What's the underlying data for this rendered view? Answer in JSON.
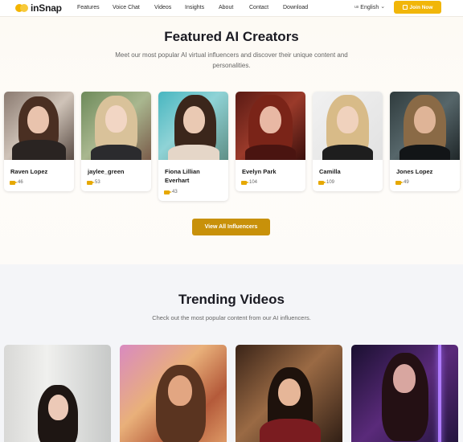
{
  "brand": {
    "name": "inSnap"
  },
  "nav": {
    "links": [
      "Features",
      "Voice Chat",
      "Videos",
      "Insights",
      "About",
      "Contact",
      "Download"
    ],
    "language": {
      "flag": "us",
      "label": "English"
    },
    "join_label": "Join Now"
  },
  "featured": {
    "title": "Featured AI Creators",
    "subtitle_line1": "Meet our most popular AI virtual influencers and discover their unique content and",
    "subtitle_line2": "personalities.",
    "creators": [
      {
        "name": "Raven Lopez",
        "videos": "46"
      },
      {
        "name": "jaylee_green",
        "videos": "53"
      },
      {
        "name": "Fiona Lillian Everhart",
        "videos": "43"
      },
      {
        "name": "Evelyn Park",
        "videos": "104"
      },
      {
        "name": "Camilla",
        "videos": "109"
      },
      {
        "name": "Jones Lopez",
        "videos": "49"
      }
    ],
    "view_all_label": "View All Influencers"
  },
  "trending": {
    "title": "Trending Videos",
    "subtitle": "Check out the most popular content from our AI influencers."
  },
  "colors": {
    "accent": "#f1b609",
    "button_dark": "#c8910a",
    "icon": "#e6a800"
  }
}
